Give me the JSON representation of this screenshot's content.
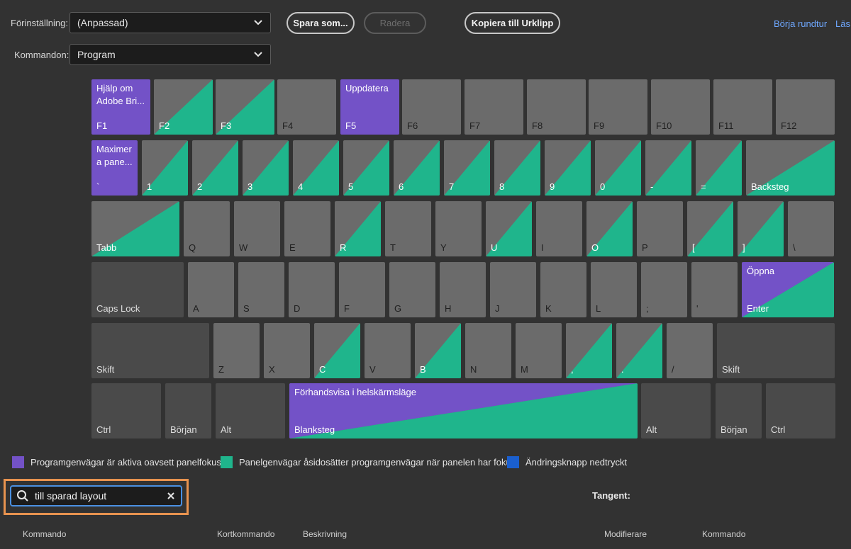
{
  "header": {
    "preset_label": "Förinställning:",
    "preset_value": "(Anpassad)",
    "commands_label": "Kommandon:",
    "commands_value": "Program",
    "save_as_label": "Spara som...",
    "delete_label": "Radera",
    "copy_label": "Kopiera till Urklipp",
    "tour_label": "Börja rundtur",
    "learn_label": "Läs"
  },
  "keyboard": {
    "rows": [
      [
        {
          "name": "F1",
          "type": "purple",
          "cmd": "Hjälp om\nAdobe Bri..."
        },
        {
          "name": "F2",
          "type": "split"
        },
        {
          "name": "F3",
          "type": "split"
        },
        {
          "name": "F4",
          "type": "plain"
        },
        {
          "name": "F5",
          "type": "purple",
          "cmd": "Uppdatera"
        },
        {
          "name": "F6",
          "type": "plain"
        },
        {
          "name": "F7",
          "type": "plain"
        },
        {
          "name": "F8",
          "type": "plain"
        },
        {
          "name": "F9",
          "type": "plain"
        },
        {
          "name": "F10",
          "type": "plain"
        },
        {
          "name": "F11",
          "type": "plain"
        },
        {
          "name": "F12",
          "type": "plain"
        }
      ],
      [
        {
          "name": "`",
          "type": "purple",
          "cmd": "Maximer\na pane..."
        },
        {
          "name": "1",
          "type": "split"
        },
        {
          "name": "2",
          "type": "split"
        },
        {
          "name": "3",
          "type": "split"
        },
        {
          "name": "4",
          "type": "split"
        },
        {
          "name": "5",
          "type": "split"
        },
        {
          "name": "6",
          "type": "split"
        },
        {
          "name": "7",
          "type": "split"
        },
        {
          "name": "8",
          "type": "split"
        },
        {
          "name": "9",
          "type": "split"
        },
        {
          "name": "0",
          "type": "split"
        },
        {
          "name": "-",
          "type": "split"
        },
        {
          "name": "=",
          "type": "split"
        },
        {
          "name": "Backsteg",
          "type": "split"
        }
      ],
      [
        {
          "name": "Tabb",
          "type": "split"
        },
        {
          "name": "Q",
          "type": "plain"
        },
        {
          "name": "W",
          "type": "plain"
        },
        {
          "name": "E",
          "type": "plain"
        },
        {
          "name": "R",
          "type": "split"
        },
        {
          "name": "T",
          "type": "plain"
        },
        {
          "name": "Y",
          "type": "plain"
        },
        {
          "name": "U",
          "type": "split"
        },
        {
          "name": "I",
          "type": "plain"
        },
        {
          "name": "O",
          "type": "split"
        },
        {
          "name": "P",
          "type": "plain"
        },
        {
          "name": "[",
          "type": "split"
        },
        {
          "name": "]",
          "type": "split"
        },
        {
          "name": "\\",
          "type": "plain"
        }
      ],
      [
        {
          "name": "Caps Lock",
          "type": "dark"
        },
        {
          "name": "A",
          "type": "plain"
        },
        {
          "name": "S",
          "type": "plain"
        },
        {
          "name": "D",
          "type": "plain"
        },
        {
          "name": "F",
          "type": "plain"
        },
        {
          "name": "G",
          "type": "plain"
        },
        {
          "name": "H",
          "type": "plain"
        },
        {
          "name": "J",
          "type": "plain"
        },
        {
          "name": "K",
          "type": "plain"
        },
        {
          "name": "L",
          "type": "plain"
        },
        {
          "name": ";",
          "type": "plain"
        },
        {
          "name": "'",
          "type": "plain"
        },
        {
          "name": "Enter",
          "type": "both",
          "cmd": "Öppna"
        }
      ],
      [
        {
          "name": "Skift",
          "type": "dark"
        },
        {
          "name": "Z",
          "type": "plain"
        },
        {
          "name": "X",
          "type": "plain"
        },
        {
          "name": "C",
          "type": "split"
        },
        {
          "name": "V",
          "type": "plain"
        },
        {
          "name": "B",
          "type": "split"
        },
        {
          "name": "N",
          "type": "plain"
        },
        {
          "name": "M",
          "type": "plain"
        },
        {
          "name": ",",
          "type": "split"
        },
        {
          "name": ".",
          "type": "split"
        },
        {
          "name": "/",
          "type": "plain"
        },
        {
          "name": "Skift",
          "type": "dark"
        }
      ],
      [
        {
          "name": "Ctrl",
          "type": "dark"
        },
        {
          "name": "Början",
          "type": "dark"
        },
        {
          "name": "Alt",
          "type": "dark"
        },
        {
          "name": "Blanksteg",
          "type": "both",
          "cmd": "Förhandsvisa i helskärmsläge"
        },
        {
          "name": "Alt",
          "type": "dark"
        },
        {
          "name": "Början",
          "type": "dark"
        },
        {
          "name": "Ctrl",
          "type": "dark"
        }
      ]
    ]
  },
  "legend": [
    {
      "color": "#7352c7",
      "text": "Programgenvägar är aktiva oavsett panelfokus"
    },
    {
      "color": "#1fb58c",
      "text": "Panelgenvägar åsidosätter programgenvägar när panelen har fokus"
    },
    {
      "color": "#1a5fcf",
      "text": "Ändringsknapp nedtryckt"
    }
  ],
  "search": {
    "value": "till sparad layout",
    "placeholder": ""
  },
  "tangent_label": "Tangent:",
  "table_headers": {
    "command": "Kommando",
    "shortcut": "Kortkommando",
    "description": "Beskrivning",
    "modifier": "Modifierare",
    "command2": "Kommando"
  },
  "colors": {
    "purple": "#7352c7",
    "green": "#1fb58c",
    "key": "#6b6b6b",
    "key_dark": "#4a4a4a"
  }
}
